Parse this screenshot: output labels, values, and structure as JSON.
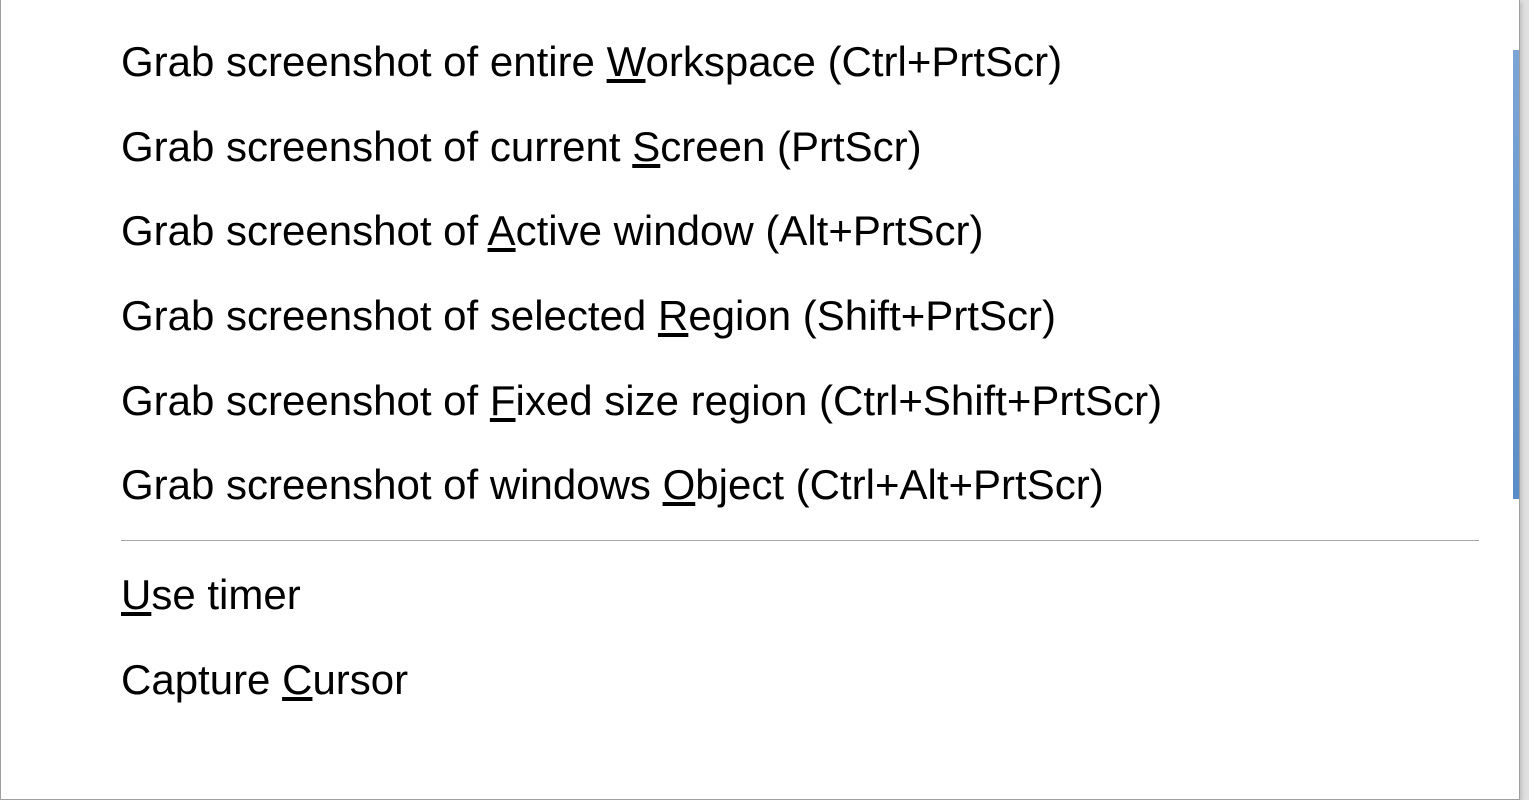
{
  "menu": {
    "items": [
      {
        "pre": "Grab screenshot of entire ",
        "mnemonic": "W",
        "post": "orkspace (Ctrl+PrtScr)"
      },
      {
        "pre": "Grab screenshot of current ",
        "mnemonic": "S",
        "post": "creen (PrtScr)"
      },
      {
        "pre": "Grab screenshot of ",
        "mnemonic": "A",
        "post": "ctive window (Alt+PrtScr)"
      },
      {
        "pre": "Grab screenshot of selected ",
        "mnemonic": "R",
        "post": "egion (Shift+PrtScr)"
      },
      {
        "pre": "Grab screenshot of ",
        "mnemonic": "F",
        "post": "ixed size region (Ctrl+Shift+PrtScr)"
      },
      {
        "pre": "Grab screenshot of windows ",
        "mnemonic": "O",
        "post": "bject (Ctrl+Alt+PrtScr)"
      }
    ],
    "options": [
      {
        "pre": "",
        "mnemonic": "U",
        "post": "se timer"
      },
      {
        "pre": "Capture ",
        "mnemonic": "C",
        "post": "ursor"
      }
    ]
  }
}
